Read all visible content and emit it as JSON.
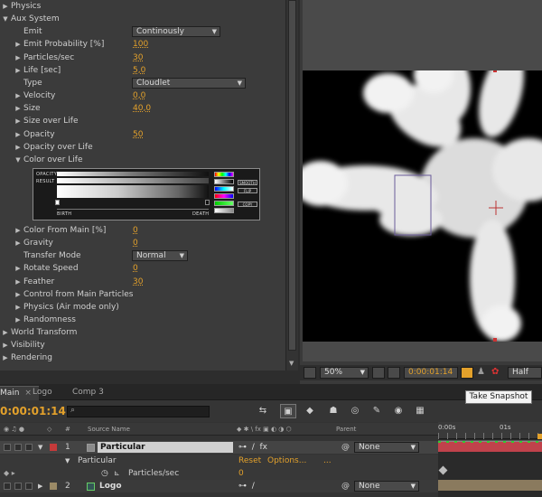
{
  "effects": {
    "rows": [
      {
        "label": "Physics",
        "depth": 0,
        "twirl": "right"
      },
      {
        "label": "Aux System",
        "depth": 0,
        "twirl": "down"
      },
      {
        "label": "Emit",
        "depth": 1,
        "dropdown": "Continously"
      },
      {
        "label": "Emit Probability [%]",
        "depth": 1,
        "twirl": "right",
        "value": "100"
      },
      {
        "label": "Particles/sec",
        "depth": 1,
        "twirl": "right",
        "value": "30"
      },
      {
        "label": "Life [sec]",
        "depth": 1,
        "twirl": "right",
        "value": "5,0"
      },
      {
        "label": "Type",
        "depth": 1,
        "dropdown": "Cloudlet"
      },
      {
        "label": "Velocity",
        "depth": 1,
        "twirl": "right",
        "value": "0,0"
      },
      {
        "label": "Size",
        "depth": 1,
        "twirl": "right",
        "value": "40,0"
      },
      {
        "label": "Size over Life",
        "depth": 1,
        "twirl": "right"
      },
      {
        "label": "Opacity",
        "depth": 1,
        "twirl": "right",
        "value": "50"
      },
      {
        "label": "Opacity over Life",
        "depth": 1,
        "twirl": "right"
      },
      {
        "label": "Color over Life",
        "depth": 1,
        "twirl": "down"
      },
      {
        "label": "Color From Main [%]",
        "depth": 1,
        "twirl": "right",
        "value": "0"
      },
      {
        "label": "Gravity",
        "depth": 1,
        "twirl": "right",
        "value": "0"
      },
      {
        "label": "Transfer Mode",
        "depth": 1,
        "dropdown": "Normal"
      },
      {
        "label": "Rotate Speed",
        "depth": 1,
        "twirl": "right",
        "value": "0"
      },
      {
        "label": "Feather",
        "depth": 1,
        "twirl": "right",
        "value": "30"
      },
      {
        "label": "Control from Main Particles",
        "depth": 1,
        "twirl": "right"
      },
      {
        "label": "Physics (Air mode only)",
        "depth": 1,
        "twirl": "right"
      },
      {
        "label": "Randomness",
        "depth": 1,
        "twirl": "right"
      },
      {
        "label": "World Transform",
        "depth": 0,
        "twirl": "right"
      },
      {
        "label": "Visibility",
        "depth": 0,
        "twirl": "right"
      },
      {
        "label": "Rendering",
        "depth": 0,
        "twirl": "right"
      }
    ],
    "gradient": {
      "opacity_label": "OPACITY",
      "result_label": "RESULT",
      "birth_label": "BIRTH",
      "death_label": "DEATH",
      "smooth_label": "SMOOTH",
      "flip_label": "FLIP",
      "copy_label": "COPY"
    }
  },
  "viewer": {
    "zoom": "50%",
    "timecode": "0:00:01:14",
    "resolution": "Half",
    "tooltip": "Take Snapshot"
  },
  "timeline": {
    "tabs": [
      {
        "label": "Main",
        "active": true
      },
      {
        "label": "Logo",
        "active": false
      },
      {
        "label": "Comp 3",
        "active": false
      }
    ],
    "timecode": "0:00:01:14",
    "columns": {
      "num": "#",
      "source": "Source Name",
      "parent": "Parent"
    },
    "ruler": {
      "start": "0:00s",
      "mark": "01s"
    },
    "layers": [
      {
        "num": "1",
        "name": "Particular",
        "parent": "None",
        "color": "#c53a3a"
      },
      {
        "num": "2",
        "name": "Logo",
        "parent": "None",
        "color": "#9b8a66"
      }
    ],
    "effect_row": {
      "name": "Particular",
      "reset": "Reset",
      "options": "Options...",
      "dots": "..."
    },
    "prop_row": {
      "name": "Particles/sec",
      "value": "0"
    }
  },
  "colors": {
    "accent": "#e3a12b",
    "panel": "#3b3b3b",
    "track_red": "#c0424b"
  }
}
